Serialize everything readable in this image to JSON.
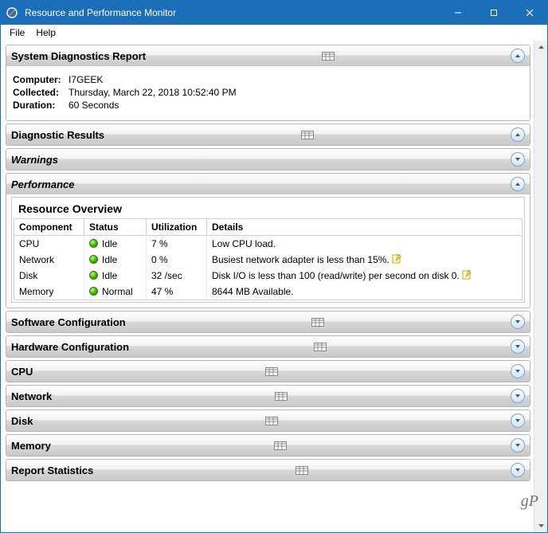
{
  "window": {
    "title": "Resource and Performance Monitor"
  },
  "menu": {
    "file": "File",
    "help": "Help"
  },
  "sections": {
    "sys_diag": "System Diagnostics Report",
    "diag_results": "Diagnostic Results",
    "warnings": "Warnings",
    "performance": "Performance",
    "resource_overview": "Resource Overview",
    "software_config": "Software Configuration",
    "hardware_config": "Hardware Configuration",
    "cpu": "CPU",
    "network": "Network",
    "disk": "Disk",
    "memory": "Memory",
    "report_stats": "Report Statistics"
  },
  "info": {
    "computer_label": "Computer:",
    "computer_value": "I7GEEK",
    "collected_label": "Collected:",
    "collected_value": "Thursday, March 22, 2018 10:52:40 PM",
    "duration_label": "Duration:",
    "duration_value": "60 Seconds"
  },
  "table": {
    "headers": {
      "component": "Component",
      "status": "Status",
      "utilization": "Utilization",
      "details": "Details"
    },
    "rows": [
      {
        "component": "CPU",
        "status": "Idle",
        "utilization": "7 %",
        "details": "Low CPU load.",
        "note": false
      },
      {
        "component": "Network",
        "status": "Idle",
        "utilization": "0 %",
        "details": "Busiest network adapter is less than 15%.",
        "note": true
      },
      {
        "component": "Disk",
        "status": "Idle",
        "utilization": "32 /sec",
        "details": "Disk I/O is less than 100 (read/write) per second on disk 0.",
        "note": true
      },
      {
        "component": "Memory",
        "status": "Normal",
        "utilization": "47 %",
        "details": "8644 MB Available.",
        "note": false
      }
    ]
  },
  "watermark": "gP"
}
